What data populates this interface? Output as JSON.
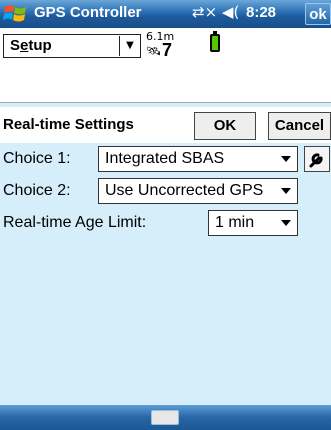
{
  "titlebar": {
    "app_title": "GPS Controller",
    "status_icons": "⇄× ◀(",
    "time": "8:28",
    "ok_label": "ok"
  },
  "toolbar": {
    "menu_label_prefix": "S",
    "menu_label_underlined": "e",
    "menu_label_suffix": "tup",
    "accuracy": "6.1m",
    "satellite_count": "7"
  },
  "settings": {
    "title": "Real-time Settings",
    "ok_button": "OK",
    "cancel_button": "Cancel",
    "choice1_label": "Choice 1:",
    "choice1_value": "Integrated SBAS",
    "choice2_label": "Choice 2:",
    "choice2_value": "Use Uncorrected GPS",
    "age_label": "Real-time Age Limit:",
    "age_value": "1 min"
  },
  "colors": {
    "content_bg": "#d6eefa",
    "battery_fill": "#53c900"
  },
  "icons": [
    "windows-start-icon",
    "connectivity-icon",
    "volume-icon",
    "satellite-icon",
    "battery-icon",
    "wrench-icon",
    "keyboard-icon"
  ]
}
